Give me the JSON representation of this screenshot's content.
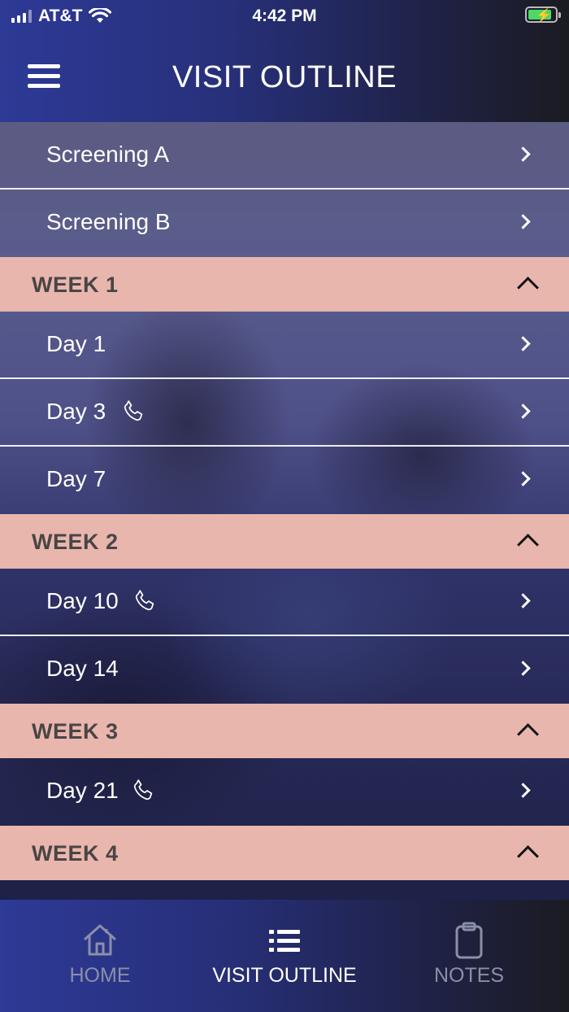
{
  "status_bar": {
    "carrier": "AT&T",
    "time": "4:42 PM",
    "battery_charging": true
  },
  "header": {
    "title": "VISIT OUTLINE",
    "menu_icon": "hamburger-menu-icon"
  },
  "visits": [
    {
      "type": "visit",
      "label": "Screening A",
      "phone": false
    },
    {
      "type": "visit",
      "label": "Screening B",
      "phone": false
    },
    {
      "type": "week",
      "label": "WEEK 1",
      "expanded": true
    },
    {
      "type": "visit",
      "label": "Day 1",
      "phone": false
    },
    {
      "type": "visit",
      "label": "Day 3",
      "phone": true
    },
    {
      "type": "visit",
      "label": "Day 7",
      "phone": false
    },
    {
      "type": "week",
      "label": "WEEK 2",
      "expanded": true
    },
    {
      "type": "visit",
      "label": "Day 10",
      "phone": true
    },
    {
      "type": "visit",
      "label": "Day 14",
      "phone": false
    },
    {
      "type": "week",
      "label": "WEEK 3",
      "expanded": true
    },
    {
      "type": "visit",
      "label": "Day 21",
      "phone": true
    },
    {
      "type": "week",
      "label": "WEEK 4",
      "expanded": true
    }
  ],
  "tabs": [
    {
      "label": "HOME",
      "icon": "home-icon",
      "active": false
    },
    {
      "label": "VISIT OUTLINE",
      "icon": "list-icon",
      "active": true
    },
    {
      "label": "NOTES",
      "icon": "clipboard-icon",
      "active": false
    }
  ],
  "colors": {
    "week_header_bg": "#e8b6ad",
    "week_header_text": "#4a4545",
    "header_gradient_start": "#2d3a96",
    "tab_inactive": "#8a8fa8",
    "tab_active": "#ffffff"
  }
}
